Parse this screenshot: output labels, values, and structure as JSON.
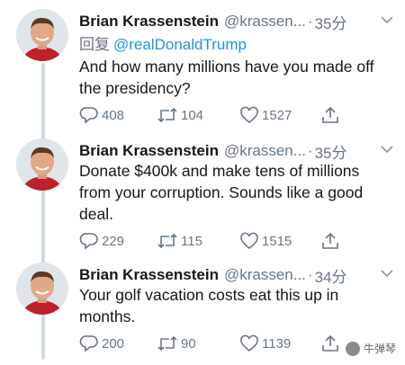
{
  "tweets": [
    {
      "name": "Brian Krassenstein",
      "handle": "@krassen...",
      "separator": "·",
      "time": "35分",
      "reply_prefix": "回复",
      "reply_to": "@realDonaldTrump",
      "text": "And how many millions have you made off the presidency?",
      "replies": "408",
      "retweets": "104",
      "likes": "1527"
    },
    {
      "name": "Brian Krassenstein",
      "handle": "@krassen...",
      "separator": "·",
      "time": "35分",
      "text": "Donate $400k and make tens of millions from your corruption. Sounds like a good deal.",
      "replies": "229",
      "retweets": "115",
      "likes": "1515"
    },
    {
      "name": "Brian Krassenstein",
      "handle": "@krassen...",
      "separator": "·",
      "time": "34分",
      "text": "Your golf vacation costs eat this up in months.",
      "replies": "200",
      "retweets": "90",
      "likes": "1139"
    }
  ],
  "watermark": {
    "text": "牛弹琴"
  },
  "icons": {
    "reply": "reply-icon",
    "retweet": "retweet-icon",
    "like": "heart-icon",
    "share": "share-icon",
    "menu": "chevron-down-icon"
  },
  "colors": {
    "text": "#14171a",
    "muted": "#657786",
    "link": "#1b95e0",
    "thread_line": "#cfd9de"
  }
}
